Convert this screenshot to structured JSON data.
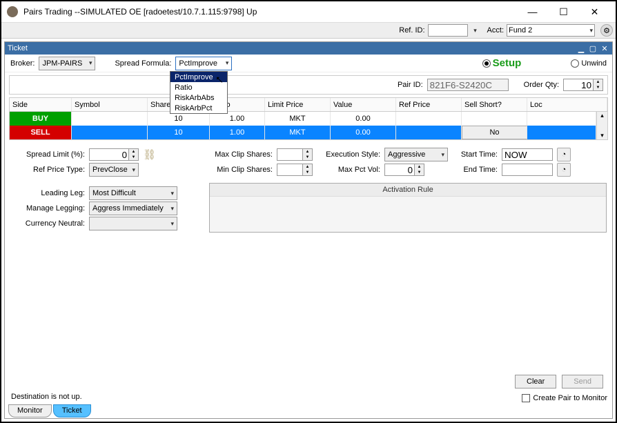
{
  "window": {
    "title": "Pairs Trading  --SIMULATED OE [radoetest/10.7.1.115:9798] Up"
  },
  "secondary": {
    "ref_id_label": "Ref. ID:",
    "acct_label": "Acct:",
    "acct_value": "Fund 2"
  },
  "panel": {
    "title": "Ticket"
  },
  "toolbar": {
    "broker_label": "Broker:",
    "broker_value": "JPM-PAIRS",
    "spread_formula_label": "Spread Formula:",
    "spread_formula_value": "PctImprove",
    "spread_formula_options": {
      "o0": "PctImprove",
      "o1": "Ratio",
      "o2": "RiskArbAbs",
      "o3": "RiskArbPct"
    },
    "setup_label": "Setup",
    "unwind_label": "Unwind"
  },
  "pair_row": {
    "pair_id_label": "Pair ID:",
    "pair_id_value": "821F6-S2420C",
    "order_qty_label": "Order Qty:",
    "order_qty_value": "10"
  },
  "grid": {
    "headers": {
      "side": "Side",
      "symbol": "Symbol",
      "shares": "Shares",
      "ratio": "Ratio",
      "limit": "Limit Price",
      "value": "Value",
      "refprice": "Ref Price",
      "sellshort": "Sell Short?",
      "loc": "Loc"
    },
    "rows": [
      {
        "side": "BUY",
        "symbol": "",
        "shares": "10",
        "ratio": "1.00",
        "limit": "MKT",
        "value": "0.00",
        "refprice": "",
        "sellshort": "",
        "loc": ""
      },
      {
        "side": "SELL",
        "symbol": "",
        "shares": "10",
        "ratio": "1.00",
        "limit": "MKT",
        "value": "0.00",
        "refprice": "",
        "sellshort": "No",
        "loc": ""
      }
    ]
  },
  "form": {
    "spread_limit_label": "Spread Limit (%):",
    "spread_limit_value": "0",
    "ref_price_type_label": "Ref Price Type:",
    "ref_price_type_value": "PrevClose",
    "max_clip_label": "Max Clip Shares:",
    "min_clip_label": "Min Clip Shares:",
    "exec_style_label": "Execution Style:",
    "exec_style_value": "Aggressive",
    "max_pct_vol_label": "Max Pct Vol:",
    "max_pct_vol_value": "0",
    "start_time_label": "Start Time:",
    "start_time_value": "NOW",
    "end_time_label": "End Time:",
    "leading_leg_label": "Leading Leg:",
    "leading_leg_value": "Most Difficult",
    "manage_legging_label": "Manage Legging:",
    "manage_legging_value": "Aggress Immediately",
    "currency_neutral_label": "Currency Neutral:",
    "activation_rule_label": "Activation Rule"
  },
  "buttons": {
    "clear": "Clear",
    "send": "Send"
  },
  "status": "Destination is not up.",
  "create_pair_label": "Create Pair to Monitor",
  "tabs": {
    "monitor": "Monitor",
    "ticket": "Ticket"
  }
}
